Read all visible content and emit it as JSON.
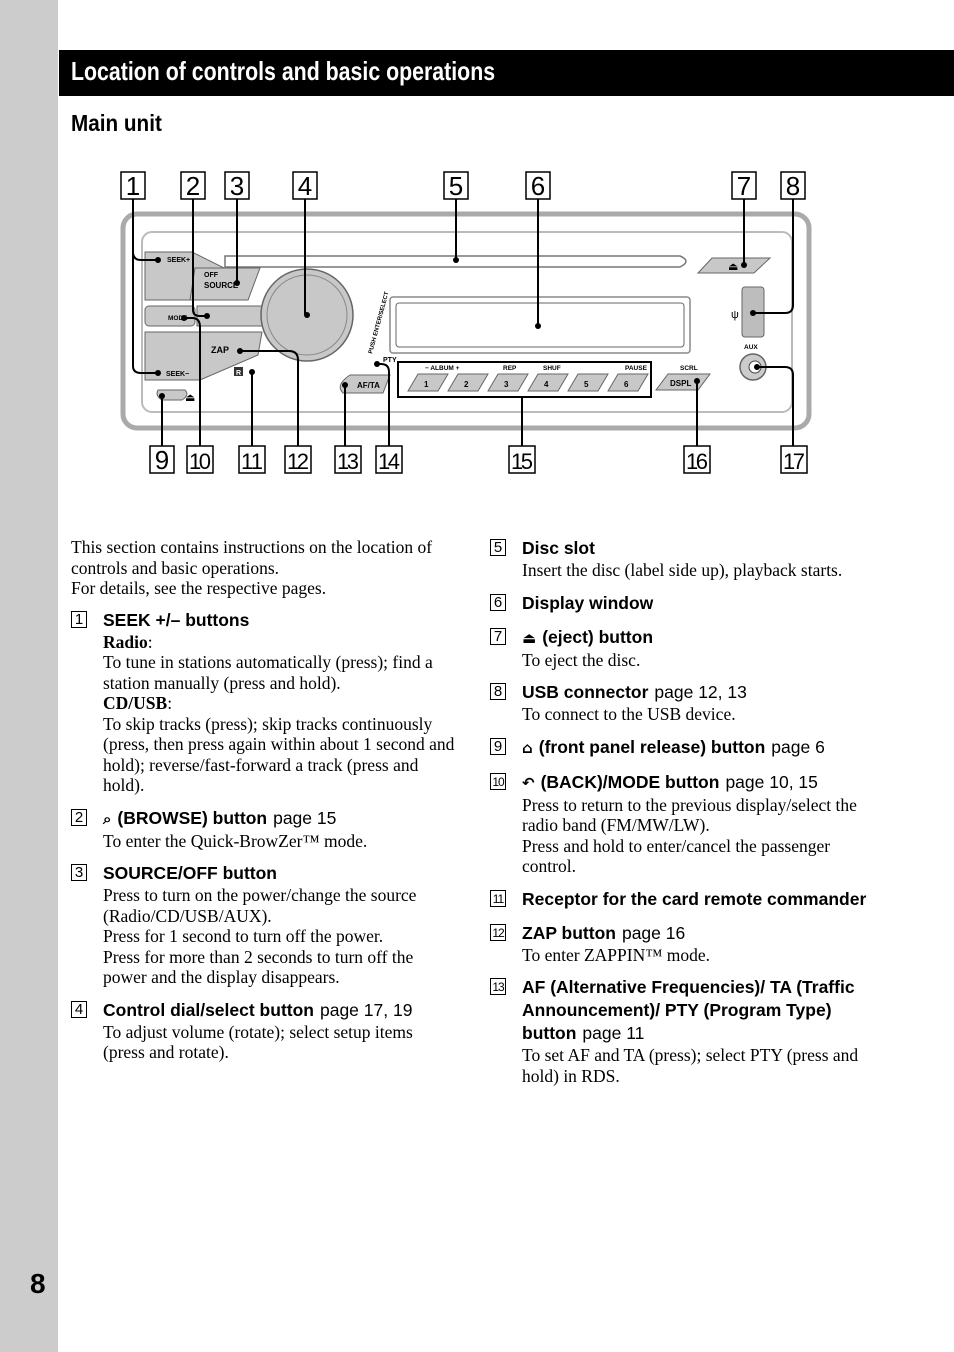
{
  "page": {
    "number": "8",
    "title": "Location of controls and basic operations",
    "subtitle": "Main unit"
  },
  "diagram": {
    "callouts": [
      "1",
      "2",
      "3",
      "4",
      "5",
      "6",
      "7",
      "8",
      "9",
      "10",
      "11",
      "12",
      "13",
      "14",
      "15",
      "16",
      "17"
    ],
    "labels": {
      "seek_plus": "SEEK+",
      "seek_minus": "SEEK−",
      "off": "OFF",
      "source": "SOURCE",
      "mode": "MODE",
      "zap": "ZAP",
      "push_enter_select": "PUSH ENTER/SELECT",
      "pty": "PTY",
      "af_ta": "AF/TA",
      "album": "−  ALBUM  +",
      "rep": "REP",
      "shuf": "SHUF",
      "pause": "PAUSE",
      "scrl": "SCRL",
      "dspl": "DSPL",
      "aux": "AUX",
      "remote_r": "R",
      "presets": [
        "1",
        "2",
        "3",
        "4",
        "5",
        "6"
      ]
    }
  },
  "intro": [
    "This section contains instructions on the location of controls and basic operations.",
    "For details, see the respective pages."
  ],
  "items": [
    {
      "num": "1",
      "title": "SEEK +/– buttons",
      "page": "",
      "body": [
        {
          "sub": "Radio"
        },
        {
          "text": "To tune in stations automatically (press); find a station manually (press and hold)."
        },
        {
          "sub": "CD/USB"
        },
        {
          "text": "To skip tracks (press); skip tracks continuously (press, then press again within about 1 second and hold); reverse/fast-forward a track (press and hold)."
        }
      ]
    },
    {
      "num": "2",
      "icon": "browse-icon",
      "title": "(BROWSE) button",
      "page": "page 15",
      "body": [
        {
          "text": "To enter the Quick-BrowZer™ mode."
        }
      ]
    },
    {
      "num": "3",
      "title": "SOURCE/OFF button",
      "page": "",
      "body": [
        {
          "text": "Press to turn on the power/change the source (Radio/CD/USB/AUX)."
        },
        {
          "text": "Press for 1 second to turn off the power."
        },
        {
          "text": "Press for more than 2 seconds to turn off the power and the display disappears."
        }
      ]
    },
    {
      "num": "4",
      "title": "Control dial/select button",
      "page": "page 17, 19",
      "body": [
        {
          "text": "To adjust volume (rotate); select setup items (press and rotate)."
        }
      ]
    },
    {
      "num": "5",
      "title": "Disc slot",
      "page": "",
      "body": [
        {
          "text": "Insert the disc (label side up), playback starts."
        }
      ]
    },
    {
      "num": "6",
      "title": "Display window",
      "page": "",
      "body": []
    },
    {
      "num": "7",
      "icon": "eject-icon",
      "title": "(eject) button",
      "page": "",
      "body": [
        {
          "text": "To eject the disc."
        }
      ]
    },
    {
      "num": "8",
      "title": "USB connector",
      "page": "page 12, 13",
      "body": [
        {
          "text": "To connect to the USB device."
        }
      ]
    },
    {
      "num": "9",
      "icon": "front-panel-release-icon",
      "title": "(front panel release) button",
      "page": "page 6",
      "body": []
    },
    {
      "num": "10",
      "icon": "back-icon",
      "title": "(BACK)/MODE button",
      "page": "page 10, 15",
      "body": [
        {
          "text": "Press to return to the previous display/select the radio band (FM/MW/LW)."
        },
        {
          "text": "Press and hold to enter/cancel the passenger control."
        }
      ]
    },
    {
      "num": "11",
      "title": "Receptor for the card remote commander",
      "page": "",
      "body": []
    },
    {
      "num": "12",
      "title": "ZAP button",
      "page": "page 16",
      "body": [
        {
          "text": "To enter ZAPPIN™ mode."
        }
      ]
    },
    {
      "num": "13",
      "title": "AF (Alternative Frequencies)/ TA (Traffic Announcement)/ PTY (Program Type) button",
      "page": "page 11",
      "body": [
        {
          "text": "To set AF and TA (press); select PTY (press and hold) in RDS."
        }
      ]
    }
  ],
  "icons": {
    "browse-icon": "🔍",
    "eject-icon": "⏏",
    "front-panel-release-icon": "⌂",
    "back-icon": "↶"
  }
}
